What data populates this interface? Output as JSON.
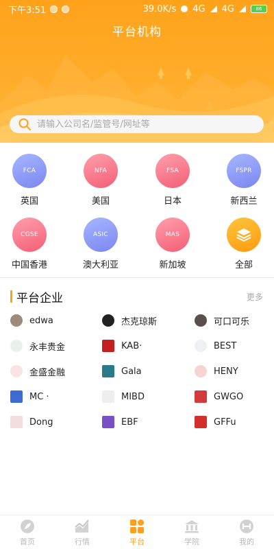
{
  "status": {
    "time": "下午3:51",
    "speed": "39.0K/s",
    "network1": "4G",
    "network2": "4G",
    "battery": "86"
  },
  "header": {
    "title": "平台机构"
  },
  "search": {
    "placeholder": "请输入公司名/监管号/网址等"
  },
  "categories": [
    {
      "abbr": "FCA",
      "label": "英国",
      "color": "blue"
    },
    {
      "abbr": "NFA",
      "label": "美国",
      "color": "pink"
    },
    {
      "abbr": "FSA",
      "label": "日本",
      "color": "pink"
    },
    {
      "abbr": "FSPR",
      "label": "新西兰",
      "color": "blue"
    },
    {
      "abbr": "CGSE",
      "label": "中国香港",
      "color": "pink"
    },
    {
      "abbr": "ASIC",
      "label": "澳大利亚",
      "color": "blue"
    },
    {
      "abbr": "MAS",
      "label": "新加坡",
      "color": "pink"
    },
    {
      "abbr": "",
      "label": "全部",
      "color": "orange"
    }
  ],
  "section": {
    "title": "平台企业",
    "more": "更多"
  },
  "companies": [
    {
      "name": "edwa"
    },
    {
      "name": "杰克琼斯"
    },
    {
      "name": "可口可乐"
    },
    {
      "name": "永丰贵金"
    },
    {
      "name": "KAB·"
    },
    {
      "name": "BEST"
    },
    {
      "name": "金盛金融"
    },
    {
      "name": "Gala"
    },
    {
      "name": "HENY"
    },
    {
      "name": "MC ·"
    },
    {
      "name": "MIBD"
    },
    {
      "name": "GWGO"
    },
    {
      "name": "Dong"
    },
    {
      "name": "EBF"
    },
    {
      "name": "GFFu"
    }
  ],
  "tabs": [
    {
      "label": "首页",
      "icon": "home-leaf-icon"
    },
    {
      "label": "行情",
      "icon": "chart-icon"
    },
    {
      "label": "平台",
      "icon": "grid-icon"
    },
    {
      "label": "学院",
      "icon": "bank-icon"
    },
    {
      "label": "我的",
      "icon": "user-icon"
    }
  ],
  "active_tab": "平台",
  "colors": {
    "accent": "#ffa21a",
    "blue_circle": "#8b97f5",
    "pink_circle": "#f5788a",
    "inactive_tab": "#c5c5c5"
  }
}
